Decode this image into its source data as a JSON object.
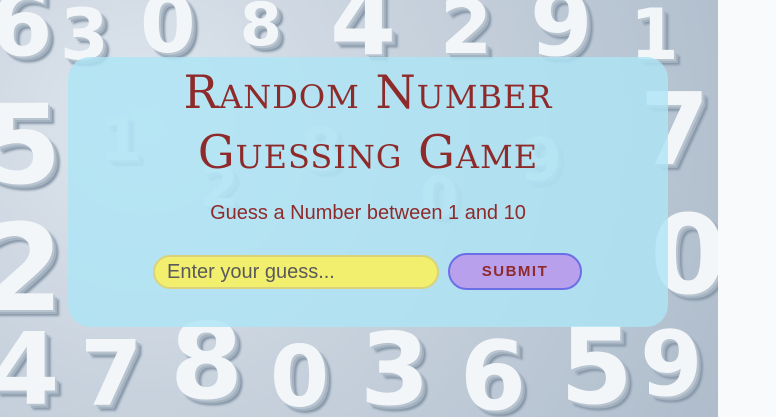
{
  "game": {
    "title_line1": "Random Number",
    "title_line2": "Guessing Game",
    "instructions": "Guess a Number between 1 and 10",
    "guess_input": {
      "placeholder": "Enter your guess...",
      "value": ""
    },
    "submit_label": "SUBMIT"
  },
  "colors": {
    "title": "#8e2a2a",
    "panel": "#ade4f5",
    "input_bg": "#f3ef6e",
    "button_bg": "#b9a0ec",
    "button_border": "#6b6fe6"
  },
  "background": {
    "icon": "3d-numbers-background-image"
  }
}
